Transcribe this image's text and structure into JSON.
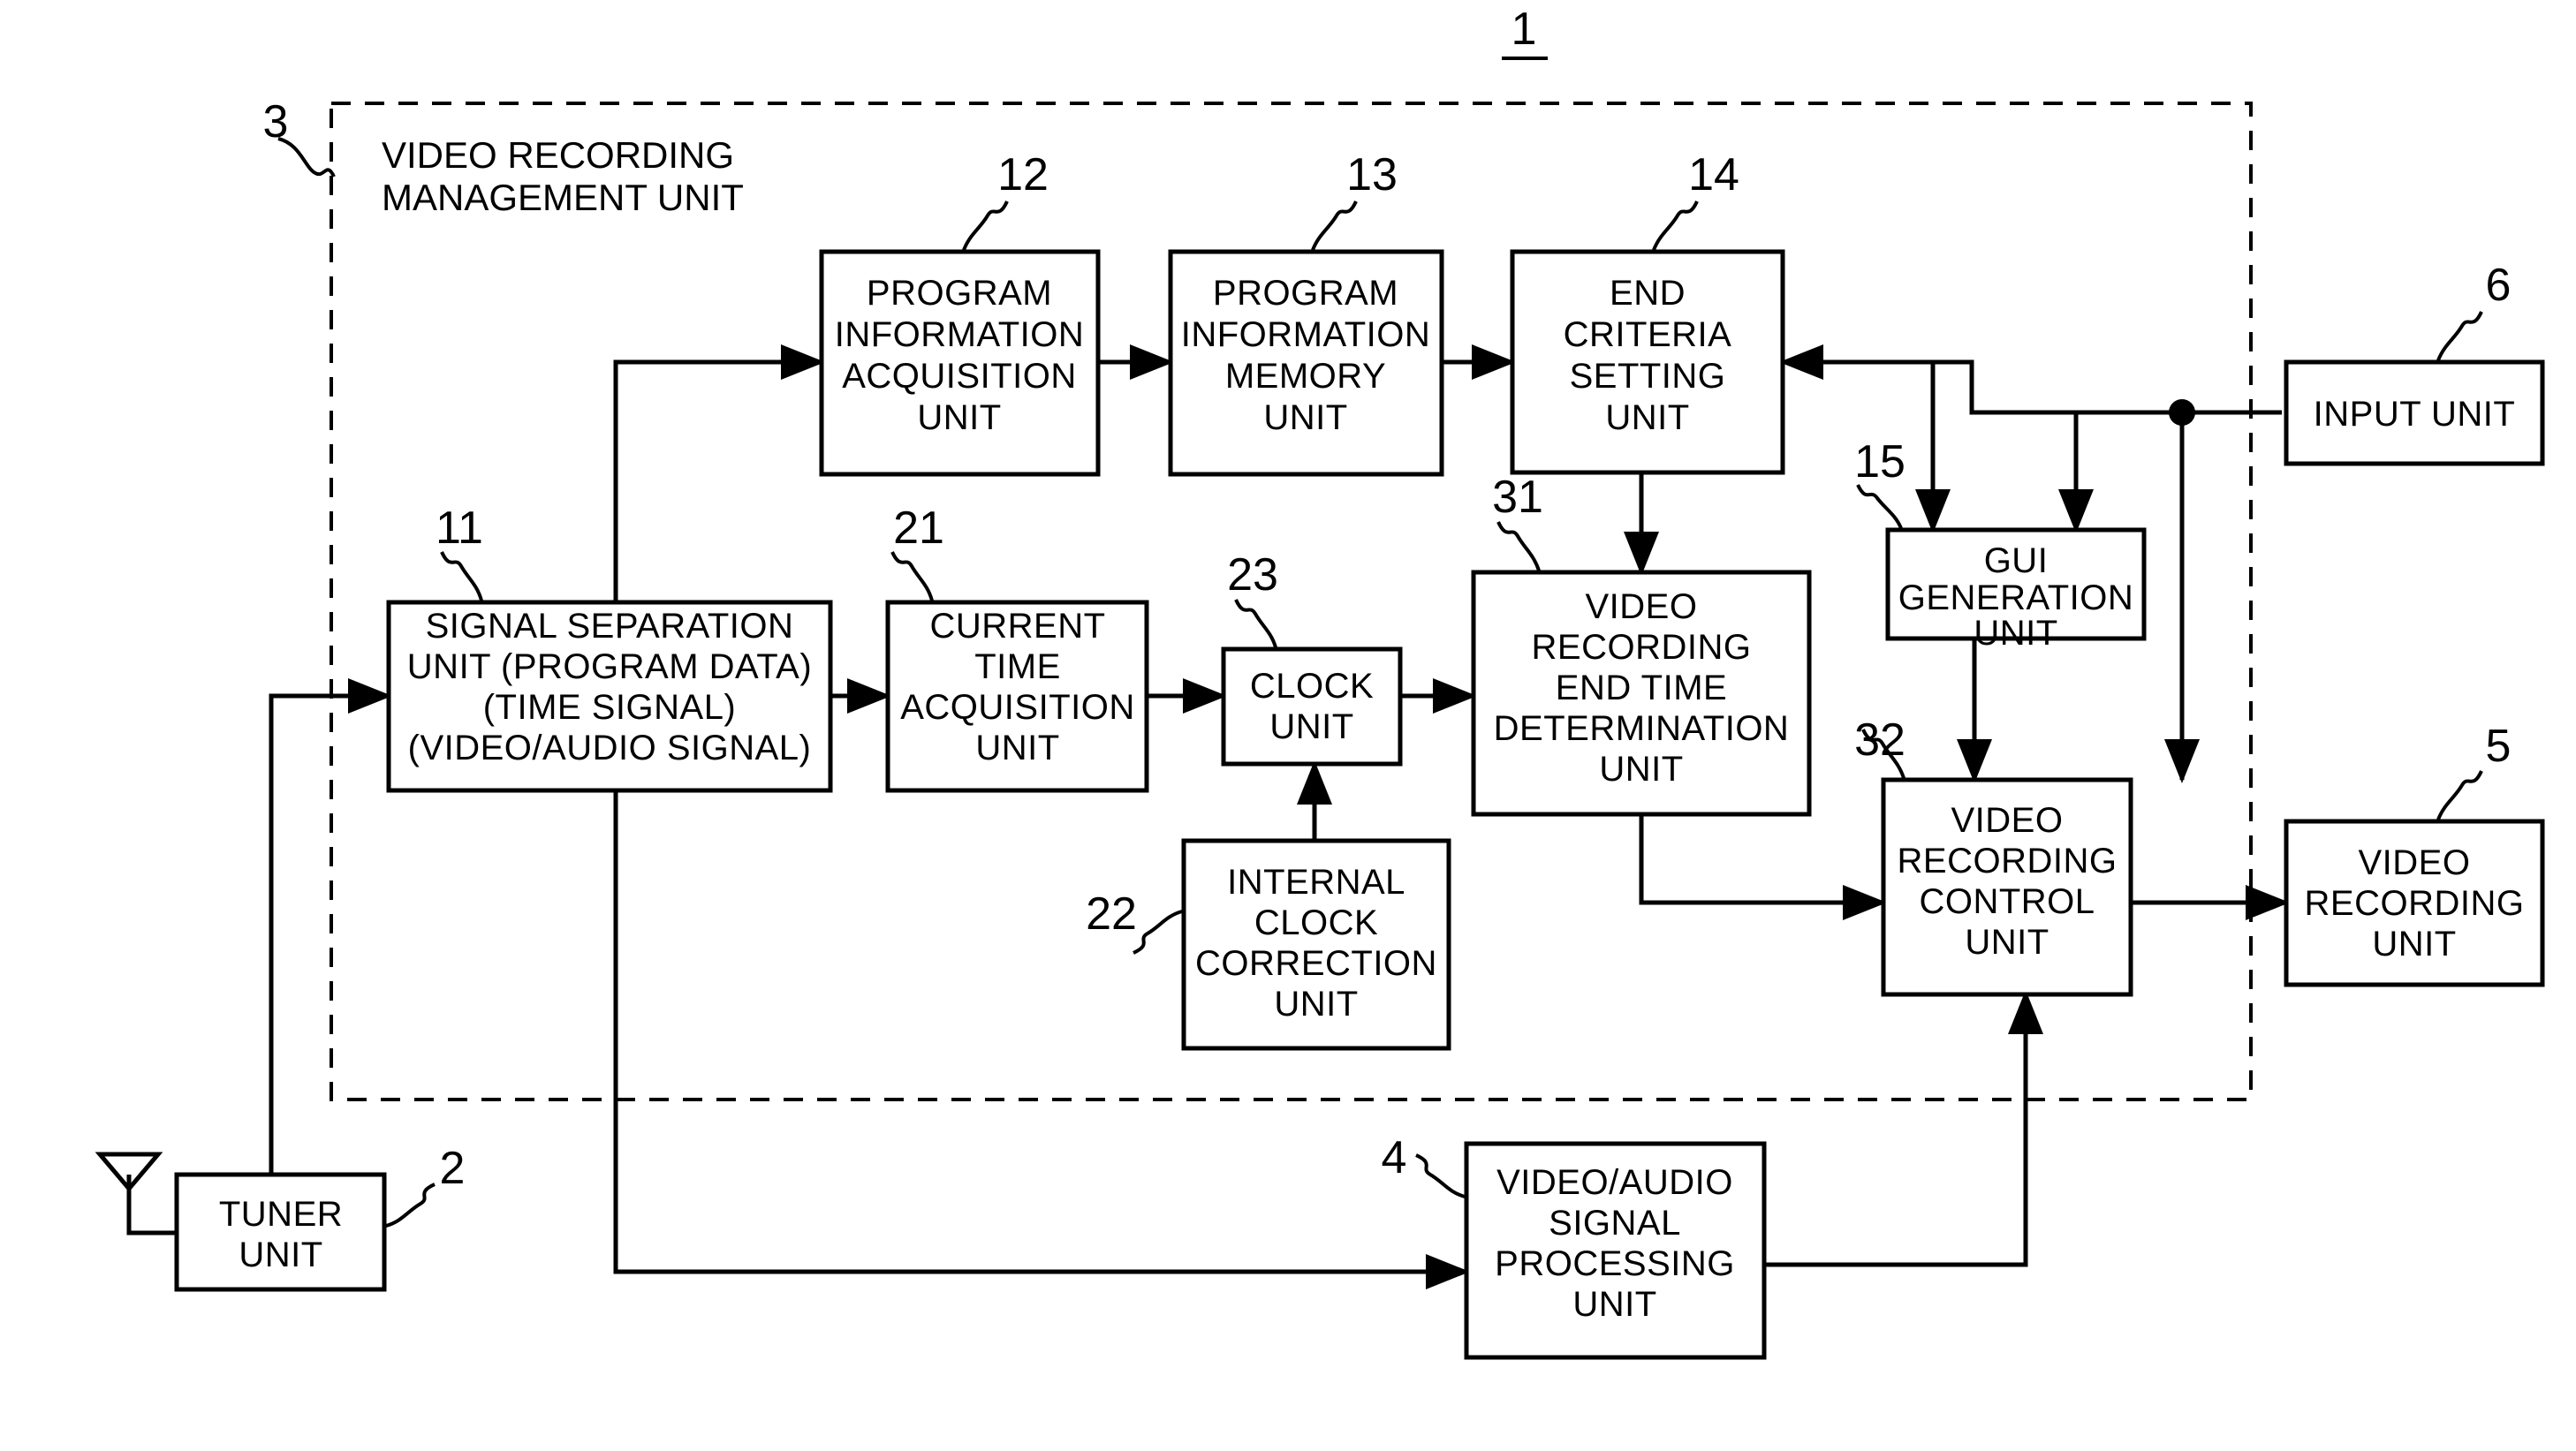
{
  "figure": {
    "number": "1",
    "frame_label_line1": "VIDEO RECORDING",
    "frame_label_line2": "MANAGEMENT UNIT",
    "frame_ref": "3"
  },
  "blocks": {
    "program_info_acquisition": {
      "ref": "12",
      "lines": [
        "PROGRAM",
        "INFORMATION",
        "ACQUISITION",
        "UNIT"
      ]
    },
    "program_info_memory": {
      "ref": "13",
      "lines": [
        "PROGRAM",
        "INFORMATION",
        "MEMORY",
        "UNIT"
      ]
    },
    "end_criteria_setting": {
      "ref": "14",
      "lines": [
        "END",
        "CRITERIA",
        "SETTING",
        "UNIT"
      ]
    },
    "input_unit": {
      "ref": "6",
      "lines": [
        "INPUT UNIT"
      ]
    },
    "gui_generation": {
      "ref": "15",
      "lines": [
        "GUI",
        "GENERATION",
        "UNIT"
      ]
    },
    "signal_separation": {
      "ref": "11",
      "lines": [
        "SIGNAL SEPARATION",
        "UNIT (PROGRAM DATA)",
        "(TIME SIGNAL)",
        "(VIDEO/AUDIO SIGNAL)"
      ]
    },
    "current_time_acquisition": {
      "ref": "21",
      "lines": [
        "CURRENT",
        "TIME",
        "ACQUISITION",
        "UNIT"
      ]
    },
    "clock_unit": {
      "ref": "23",
      "lines": [
        "CLOCK",
        "UNIT"
      ]
    },
    "video_recording_end_time": {
      "ref": "31",
      "lines": [
        "VIDEO",
        "RECORDING",
        "END TIME",
        "DETERMINATION",
        "UNIT"
      ]
    },
    "video_recording_control": {
      "ref": "32",
      "lines": [
        "VIDEO",
        "RECORDING",
        "CONTROL",
        "UNIT"
      ]
    },
    "video_recording_unit": {
      "ref": "5",
      "lines": [
        "VIDEO",
        "RECORDING",
        "UNIT"
      ]
    },
    "internal_clock_correction": {
      "ref": "22",
      "lines": [
        "INTERNAL",
        "CLOCK",
        "CORRECTION",
        "UNIT"
      ]
    },
    "tuner_unit": {
      "ref": "2",
      "lines": [
        "TUNER",
        "UNIT"
      ]
    },
    "video_audio_signal_processing": {
      "ref": "4",
      "lines": [
        "VIDEO/AUDIO",
        "SIGNAL",
        "PROCESSING",
        "UNIT"
      ]
    }
  },
  "colors": {
    "stroke": "#000000",
    "background": "#ffffff"
  }
}
